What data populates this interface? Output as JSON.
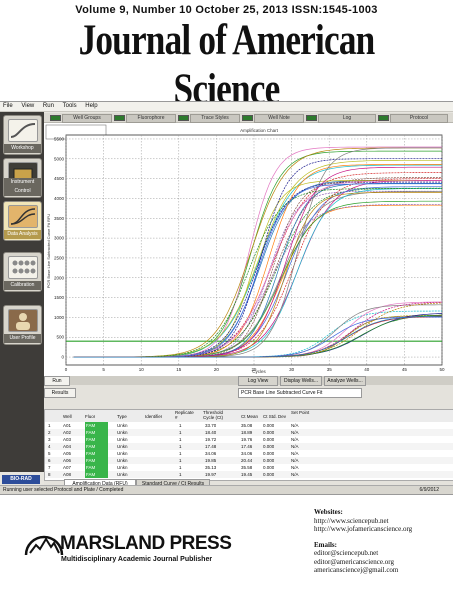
{
  "header": {
    "issue_line": "Volume 9, Number 10  October 25, 2013  ISSN:1545-1003",
    "journal_title": "Journal of American Science"
  },
  "screenshot": {
    "menu": [
      "File",
      "View",
      "Run",
      "Tools",
      "Help"
    ],
    "toolbar_buttons": [
      "Well Groups",
      "Fluorophore",
      "Trace Styles",
      "Well Note",
      "Log",
      "Protocol"
    ],
    "sidebar": [
      {
        "label": "Workshop",
        "icon": "amplification-curve-icon"
      },
      {
        "label": "Instrument Control",
        "icon": "instrument-icon"
      },
      {
        "label": "Data Analysis",
        "icon": "analysis-icon"
      },
      {
        "label": "Calibration",
        "icon": "plate-grid-icon"
      },
      {
        "label": "User Profile",
        "icon": "user-profile-icon"
      }
    ],
    "plot_title": "Amplification Chart",
    "y_axis_label": "PCR Base Line Subtracted Curve Fit RFU",
    "x_axis_label": "Cycles",
    "panel_buttons": [
      "Log View",
      "Display Wells...",
      "Analyze Wells..."
    ],
    "tabs": [
      "Run",
      "Results"
    ],
    "analysis_mode": "PCR Base Line Subtracted Curve Fit",
    "table_headers": [
      "Well",
      "Fluor",
      "Type",
      "Identifier",
      "Replicate #",
      "Threshold Cycle (Ct)",
      "Ct Mean",
      "Ct Std. Dev",
      "Set Point"
    ],
    "table_rows": [
      [
        "A01",
        "FAM",
        "Unkn",
        "",
        "1",
        "33.70",
        "35.08",
        "0.000",
        "N/A"
      ],
      [
        "A02",
        "FAM",
        "Unkn",
        "",
        "1",
        "18.40",
        "18.89",
        "0.000",
        "N/A"
      ],
      [
        "A03",
        "FAM",
        "Unkn",
        "",
        "1",
        "19.72",
        "19.76",
        "0.000",
        "N/A"
      ],
      [
        "A04",
        "FAM",
        "Unkn",
        "",
        "1",
        "17.48",
        "17.46",
        "0.000",
        "N/A"
      ],
      [
        "A05",
        "FAM",
        "Unkn",
        "",
        "1",
        "34.06",
        "34.06",
        "0.000",
        "N/A"
      ],
      [
        "A06",
        "FAM",
        "Unkn",
        "",
        "1",
        "19.85",
        "20.44",
        "0.000",
        "N/A"
      ],
      [
        "A07",
        "FAM",
        "Unkn",
        "",
        "1",
        "35.13",
        "35.58",
        "0.000",
        "N/A"
      ],
      [
        "A08",
        "FAM",
        "Unkn",
        "",
        "1",
        "19.97",
        "19.45",
        "0.000",
        "N/A"
      ]
    ],
    "bottom_tabs": [
      "Amplification Data (RFU)",
      "Standard Curve / Ct Results"
    ],
    "status_text": "Running user selected Protocol and Plate / Completed",
    "status_date": "6/9/2012",
    "brand": "BIO-RAD"
  },
  "chart_data": {
    "type": "line",
    "title": "Amplification Chart",
    "xlabel": "Cycles",
    "ylabel": "PCR Base Line Subtracted Curve Fit RFU",
    "xlim": [
      0,
      50
    ],
    "ylim": [
      -200,
      5600
    ],
    "xticks": [
      0,
      5,
      10,
      15,
      20,
      25,
      30,
      35,
      40,
      45,
      50
    ],
    "yticks": [
      0,
      500,
      1000,
      1500,
      2000,
      2500,
      3000,
      3500,
      4000,
      4500,
      5000,
      5500
    ],
    "threshold": 400,
    "group_high": {
      "ct_range": [
        19,
        26
      ],
      "plateau_range": [
        3700,
        5400
      ],
      "count": 30
    },
    "group_low": {
      "ct_range": [
        30,
        35
      ],
      "plateau_range": [
        1000,
        1450
      ],
      "count": 12
    }
  },
  "publisher": {
    "name": "MARSLAND PRESS",
    "tagline": "Multidisciplinary Academic Journal Publisher"
  },
  "contact": {
    "websites_label": "Websites:",
    "websites": [
      "http://www.sciencepub.net",
      "http://www.jofamericanscience.org"
    ],
    "emails_label": "Emails:",
    "emails": [
      "editor@sciencepub.net",
      "editor@americanscience.org",
      "americansciencej@gmail.com"
    ]
  },
  "colors": {
    "fam_green": "#39b54a",
    "sidebar_bg": "#3e3c39",
    "threshold_line": "#2aa02a"
  }
}
